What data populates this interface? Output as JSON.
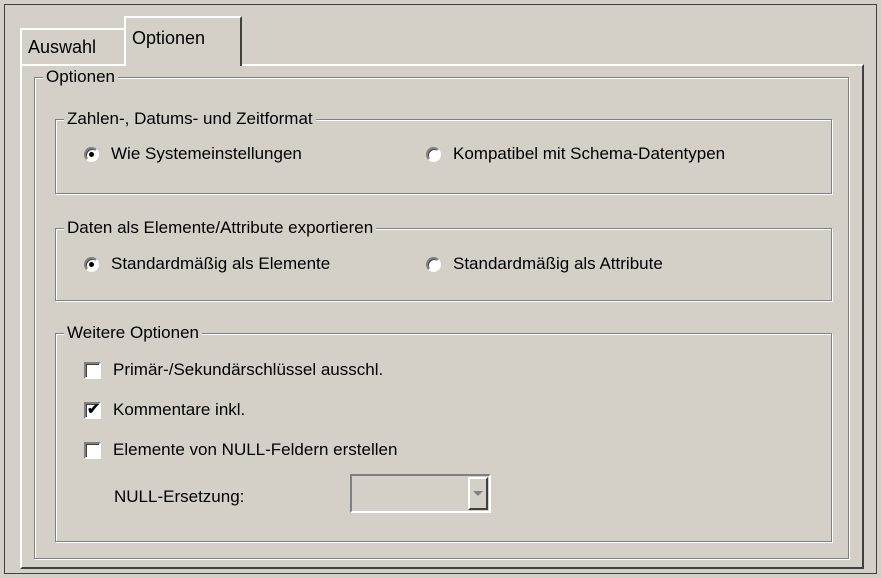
{
  "tabs": [
    {
      "label": "Auswahl",
      "active": false
    },
    {
      "label": "Optionen",
      "active": true
    }
  ],
  "options_group": {
    "title": "Optionen"
  },
  "number_format": {
    "title": "Zahlen-, Datums- und Zeitformat",
    "options": [
      {
        "label": "Wie Systemeinstellungen",
        "checked": true
      },
      {
        "label": "Kompatibel mit Schema-Datentypen",
        "checked": false
      }
    ]
  },
  "export_as": {
    "title": "Daten als Elemente/Attribute exportieren",
    "options": [
      {
        "label": "Standardmäßig als Elemente",
        "checked": true
      },
      {
        "label": "Standardmäßig als Attribute",
        "checked": false
      }
    ]
  },
  "more_options": {
    "title": "Weitere Optionen",
    "checkboxes": [
      {
        "label": "Primär-/Sekundärschlüssel ausschl.",
        "checked": false
      },
      {
        "label": "Kommentare inkl.",
        "checked": true
      },
      {
        "label": "Elemente von NULL-Feldern erstellen",
        "checked": false
      }
    ],
    "null_replacement": {
      "label": "NULL-Ersetzung:",
      "value": "",
      "enabled": false
    }
  },
  "icons": {
    "check": "✔",
    "dropdown": "chevron-down-icon"
  }
}
